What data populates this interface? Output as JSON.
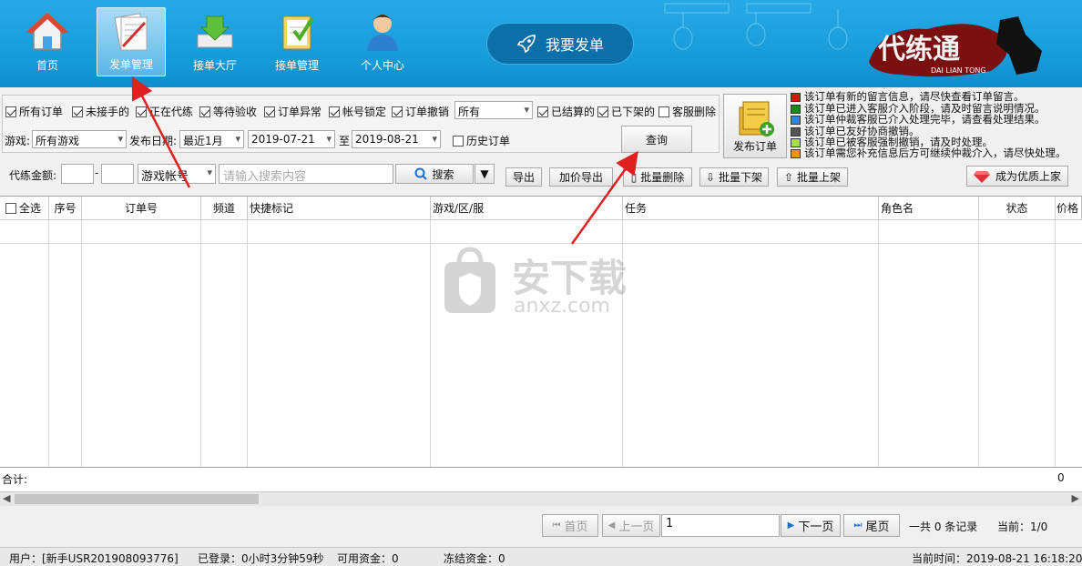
{
  "nav": {
    "items": [
      {
        "label": "首页",
        "icon": "home-icon"
      },
      {
        "label": "发单管理",
        "icon": "order-manage-icon"
      },
      {
        "label": "接单大厅",
        "icon": "order-hall-icon"
      },
      {
        "label": "接单管理",
        "icon": "accept-manage-icon"
      },
      {
        "label": "个人中心",
        "icon": "user-icon"
      }
    ],
    "send_label": "我要发单",
    "logo_text": "代练通",
    "logo_sub": "DAI LIAN TONG"
  },
  "filters": {
    "checkboxes": [
      {
        "label": "所有订单",
        "checked": true
      },
      {
        "label": "未接手的",
        "checked": true
      },
      {
        "label": "正在代练",
        "checked": true
      },
      {
        "label": "等待验收",
        "checked": true
      },
      {
        "label": "订单异常",
        "checked": true
      },
      {
        "label": "帐号锁定",
        "checked": true
      },
      {
        "label": "订单撤销",
        "checked": true
      }
    ],
    "status_select": "所有",
    "settled": {
      "label": "已结算的",
      "checked": true
    },
    "offshelf": {
      "label": "已下架的",
      "checked": true
    },
    "service_del": {
      "label": "客服删除",
      "checked": false
    },
    "game_label": "游戏:",
    "game_select": "所有游戏",
    "date_label": "发布日期:",
    "date_range": "最近1月",
    "date_from": "2019-07-21",
    "to_label": "至",
    "date_to": "2019-08-21",
    "history": {
      "label": "历史订单",
      "checked": false
    },
    "query_label": "查询",
    "amount_label": "代练金额:",
    "dash": "-",
    "search_field": "游戏帐号",
    "search_placeholder": "请输入搜索内容",
    "search_label": "搜索"
  },
  "actions": {
    "export": "导出",
    "price_export": "加价导出",
    "batch_delete": "批量删除",
    "batch_off": "批量下架",
    "batch_on": "批量上架",
    "publish": "发布订单",
    "premium": "成为优质上家"
  },
  "legend": [
    {
      "color": "#e01010",
      "text": "该订单有新的留言信息，请尽快查看订单留言。"
    },
    {
      "color": "#1a8a1a",
      "text": "该订单已进入客服介入阶段，请及时留言说明情况。"
    },
    {
      "color": "#3a7fd8",
      "text": "该订单仲裁客服已介入处理完毕，请查看处理结果。"
    },
    {
      "color": "#555555",
      "text": "该订单已友好协商撤销。"
    },
    {
      "color": "#a8e040",
      "text": "该订单已被客服强制撤销，请及时处理。"
    },
    {
      "color": "#e89020",
      "text": "该订单需您补充信息后方可继续仲裁介入，请尽快处理。"
    }
  ],
  "table": {
    "select_all": "全选",
    "columns": [
      "序号",
      "订单号",
      "频道",
      "快捷标记",
      "游戏/区/服",
      "任务",
      "角色名",
      "状态",
      "价格"
    ],
    "total_label": "合计:",
    "total_value": "0"
  },
  "watermark": {
    "text": "安下载",
    "sub": "anxz.com"
  },
  "pager": {
    "first": "首页",
    "prev": "上一页",
    "page_value": "1",
    "next": "下一页",
    "last": "尾页",
    "records": "一共 0 条记录",
    "current": "当前：1/0"
  },
  "status": {
    "user": "用户：[新手USR201908093776]",
    "login": "已登录：0小时3分钟59秒",
    "funds": "可用资金：0",
    "frozen": "冻结资金：0",
    "time": "当前时间：2019-08-21 16:18:20"
  }
}
